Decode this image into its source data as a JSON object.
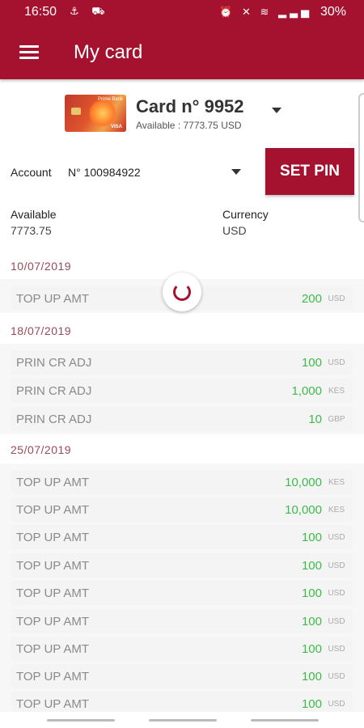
{
  "status_bar": {
    "time": "16:50",
    "left_icons": "⚓ ⛟",
    "right_icons": "⏰ ✕ ≋ ▂▃▅",
    "battery": "30%"
  },
  "app_bar": {
    "title": "My card"
  },
  "card": {
    "title": "Card n° 9952",
    "available_text": "Available : 7773.75 USD",
    "image_brand": "Prime Bank",
    "image_network": "VISA"
  },
  "account": {
    "label": "Account",
    "value": "N° 100984922"
  },
  "set_pin_label": "SET PIN",
  "balance": {
    "available_label": "Available",
    "available_value": "7773.75",
    "currency_label": "Currency",
    "currency_value": "USD"
  },
  "groups": [
    {
      "date": "10/07/2019",
      "rows": [
        {
          "desc": "TOP UP AMT",
          "amount": "200",
          "currency": "USD"
        }
      ]
    },
    {
      "date": "18/07/2019",
      "rows": [
        {
          "desc": "PRIN CR ADJ",
          "amount": "100",
          "currency": "USD"
        },
        {
          "desc": "PRIN CR ADJ",
          "amount": "1,000",
          "currency": "KES"
        },
        {
          "desc": "PRIN CR ADJ",
          "amount": "10",
          "currency": "GBP"
        }
      ]
    },
    {
      "date": "25/07/2019",
      "rows": [
        {
          "desc": "TOP UP AMT",
          "amount": "10,000",
          "currency": "KES"
        },
        {
          "desc": "TOP UP AMT",
          "amount": "10,000",
          "currency": "KES"
        },
        {
          "desc": "TOP UP AMT",
          "amount": "100",
          "currency": "USD"
        },
        {
          "desc": "TOP UP AMT",
          "amount": "100",
          "currency": "USD"
        },
        {
          "desc": "TOP UP AMT",
          "amount": "100",
          "currency": "USD"
        },
        {
          "desc": "TOP UP AMT",
          "amount": "100",
          "currency": "USD"
        },
        {
          "desc": "TOP UP AMT",
          "amount": "100",
          "currency": "USD"
        },
        {
          "desc": "TOP UP AMT",
          "amount": "100",
          "currency": "USD"
        },
        {
          "desc": "TOP UP AMT",
          "amount": "100",
          "currency": "USD"
        }
      ]
    }
  ],
  "colors": {
    "brand": "#a5122f",
    "amount": "#3dbb4a",
    "date": "#9a4a5a",
    "row_bg": "#f4f4f4"
  },
  "icons": {
    "menu": "hamburger-menu-icon",
    "dropdown": "chevron-down-icon",
    "loading": "loading-spinner-icon"
  }
}
